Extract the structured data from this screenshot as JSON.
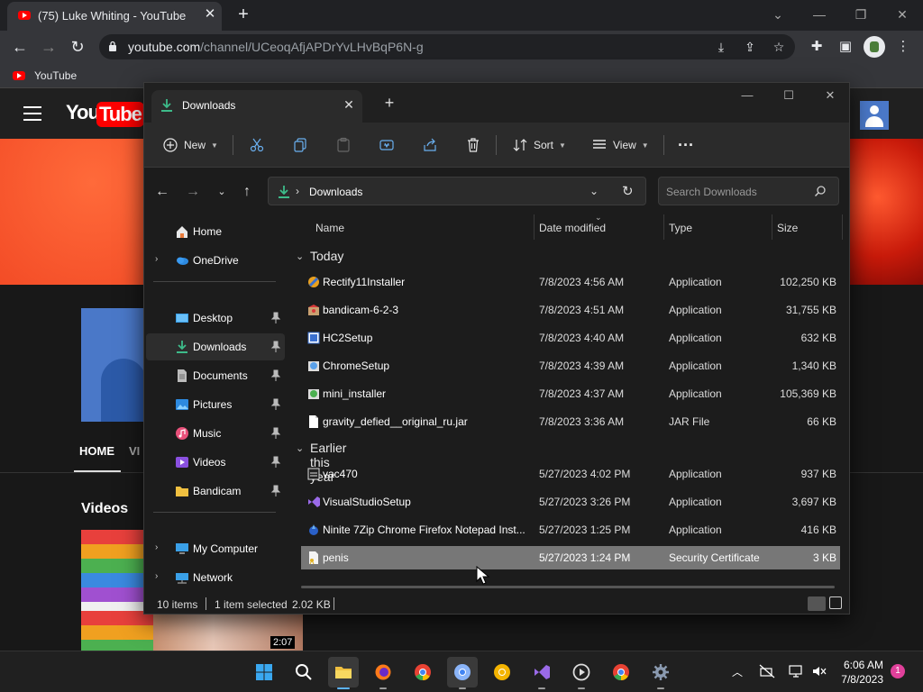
{
  "chrome": {
    "tab_title": "(75) Luke Whiting - YouTube",
    "tab_close": "✕",
    "new_tab": "+",
    "url_host": "youtube.com",
    "url_path": "/channel/UCeoqAfjAPDrYvLHvBqP6N-g",
    "bookmark_label": "YouTube"
  },
  "youtube": {
    "logo_you": "You",
    "logo_tube": "Tube",
    "tab_home": "HOME",
    "tab_videos_partial": "VI",
    "videos_heading": "Videos",
    "video_duration": "2:07"
  },
  "explorer": {
    "tab_label": "Downloads",
    "tab_close": "✕",
    "new_tab": "+",
    "cmd": {
      "new_label": "New",
      "sort_label": "Sort",
      "view_label": "View",
      "more": "···"
    },
    "address_path": "Downloads",
    "search_placeholder": "Search Downloads",
    "nav": [
      {
        "label": "Home"
      },
      {
        "label": "OneDrive"
      },
      {
        "label": "Desktop"
      },
      {
        "label": "Downloads"
      },
      {
        "label": "Documents"
      },
      {
        "label": "Pictures"
      },
      {
        "label": "Music"
      },
      {
        "label": "Videos"
      },
      {
        "label": "Bandicam"
      },
      {
        "label": "My Computer"
      },
      {
        "label": "Network"
      }
    ],
    "columns": {
      "name": "Name",
      "date": "Date modified",
      "type": "Type",
      "size": "Size"
    },
    "groups": [
      {
        "label": "Today",
        "files": [
          {
            "name": "Rectify11Installer",
            "date": "7/8/2023 4:56 AM",
            "type": "Application",
            "size": "102,250 KB"
          },
          {
            "name": "bandicam-6-2-3",
            "date": "7/8/2023 4:51 AM",
            "type": "Application",
            "size": "31,755 KB"
          },
          {
            "name": "HC2Setup",
            "date": "7/8/2023 4:40 AM",
            "type": "Application",
            "size": "632 KB"
          },
          {
            "name": "ChromeSetup",
            "date": "7/8/2023 4:39 AM",
            "type": "Application",
            "size": "1,340 KB"
          },
          {
            "name": "mini_installer",
            "date": "7/8/2023 4:37 AM",
            "type": "Application",
            "size": "105,369 KB"
          },
          {
            "name": "gravity_defied__original_ru.jar",
            "date": "7/8/2023 3:36 AM",
            "type": "JAR File",
            "size": "66 KB"
          }
        ]
      },
      {
        "label": "Earlier this year",
        "files": [
          {
            "name": "vac470",
            "date": "5/27/2023 4:02 PM",
            "type": "Application",
            "size": "937 KB"
          },
          {
            "name": "VisualStudioSetup",
            "date": "5/27/2023 3:26 PM",
            "type": "Application",
            "size": "3,697 KB"
          },
          {
            "name": "Ninite 7Zip Chrome Firefox Notepad Inst...",
            "date": "5/27/2023 1:25 PM",
            "type": "Application",
            "size": "416 KB"
          },
          {
            "name": "penis",
            "date": "5/27/2023 1:24 PM",
            "type": "Security Certificate",
            "size": "3 KB"
          }
        ]
      }
    ],
    "status": {
      "count": "10 items",
      "selected": "1 item selected",
      "size": "2.02 KB"
    }
  },
  "taskbar": {
    "time": "6:06 AM",
    "date": "7/8/2023",
    "notifications": "1"
  },
  "colors": {
    "accent": "#5cb3ff",
    "youtube_red": "#ff0000",
    "selection_row": "#777777",
    "explorer_bg": "#1c1c1c"
  }
}
